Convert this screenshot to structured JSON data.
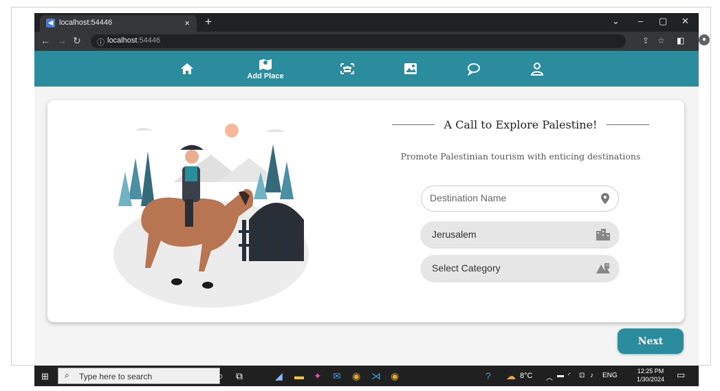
{
  "browser": {
    "tab_title": "localhost:54446",
    "tab_close": "×",
    "new_tab": "+",
    "url_host": "localhost",
    "url_port": ":54446",
    "window_controls": [
      "⌄",
      "–",
      "▢",
      "✕"
    ]
  },
  "nav": {
    "items": [
      {
        "icon": "home-icon",
        "glyph": "🏠",
        "label": ""
      },
      {
        "icon": "map-pin-icon",
        "glyph": "🗺",
        "label": "Add Place"
      },
      {
        "icon": "group-scan-icon",
        "glyph": "👥",
        "label": ""
      },
      {
        "icon": "photo-gallery-icon",
        "glyph": "🖼",
        "label": ""
      },
      {
        "icon": "chat-icon",
        "glyph": "💬",
        "label": ""
      },
      {
        "icon": "user-icon",
        "glyph": "👤",
        "label": ""
      }
    ]
  },
  "form": {
    "heading": "A Call to Explore Palestine!",
    "subtitle": "Promote Palestinian tourism with enticing destinations",
    "destination_placeholder": "Destination Name",
    "city_value": "Jerusalem",
    "category_value": "Select Category",
    "next_label": "Next"
  },
  "taskbar": {
    "search_placeholder": "Type here to search",
    "weather": "8°C",
    "language": "ENG",
    "time": "12:25 PM",
    "date": "1/30/2024"
  },
  "colors": {
    "accent": "#2b8c9d",
    "page_bg": "#f4f4f4"
  }
}
